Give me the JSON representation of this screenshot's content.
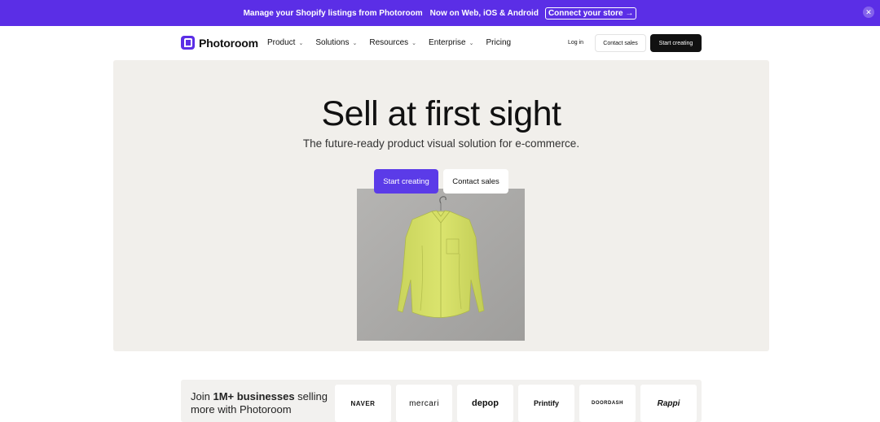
{
  "banner": {
    "message": "Manage your Shopify listings from Photoroom",
    "platforms": "Now on Web, iOS & Android",
    "cta": "Connect your store →",
    "close_glyph": "✕"
  },
  "nav": {
    "brand": "Photoroom",
    "menu": [
      {
        "label": "Product",
        "has_dropdown": true
      },
      {
        "label": "Solutions",
        "has_dropdown": true
      },
      {
        "label": "Resources",
        "has_dropdown": true
      },
      {
        "label": "Enterprise",
        "has_dropdown": true
      },
      {
        "label": "Pricing",
        "has_dropdown": false
      }
    ],
    "chevron": "⌄",
    "login": "Log in",
    "contact_sales": "Contact sales",
    "start_creating": "Start creating"
  },
  "hero": {
    "title": "Sell at first sight",
    "subtitle": "The future-ready product visual solution for e-commerce.",
    "primary_cta": "Start creating",
    "secondary_cta": "Contact sales"
  },
  "trust": {
    "prefix": "Join ",
    "highlight": "1M+ businesses",
    "suffix": " selling more with Photoroom",
    "logos": [
      "NAVER",
      "mercari",
      "depop",
      "Printify",
      "DOORDASH",
      "Rappi"
    ]
  },
  "colors": {
    "brand": "#5b2ee6",
    "hero_bg": "#f1efeb",
    "dark_button": "#111111"
  }
}
